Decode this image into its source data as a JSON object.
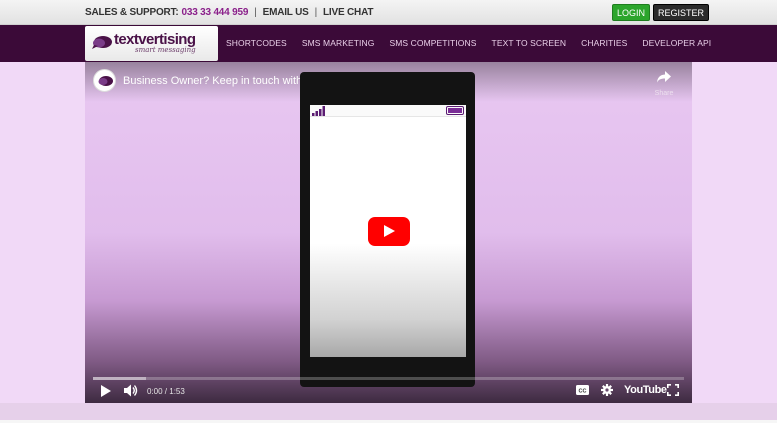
{
  "topbar": {
    "sales_label": "SALES & SUPPORT:",
    "phone": "033 33 444 959",
    "email_label": "EMAIL US",
    "chat_label": "LIVE CHAT",
    "login_label": "LOGIN",
    "register_label": "REGISTER"
  },
  "logo": {
    "wordmark": "textvertising",
    "tagline": "smart messaging"
  },
  "nav": {
    "items": [
      "SHORTCODES",
      "SMS MARKETING",
      "SMS COMPETITIONS",
      "TEXT TO SCREEN",
      "CHARITIES",
      "DEVELOPER API"
    ]
  },
  "video": {
    "title": "Business Owner? Keep in touch with customers using SMS",
    "share_label": "Share",
    "time": "0:00 / 1:53",
    "youtube_label": "YouTube",
    "buffered_fraction": 0.09
  },
  "colors": {
    "brand_purple": "#3b0a38",
    "accent_phone": "#8a1f8a",
    "login_green": "#2ca52c",
    "youtube_red": "#ff0000"
  },
  "icons": [
    "speech-bubble-icon",
    "share-icon",
    "signal-icon",
    "battery-icon",
    "play-icon",
    "volume-icon",
    "cc-icon",
    "gear-icon",
    "fullscreen-icon"
  ]
}
